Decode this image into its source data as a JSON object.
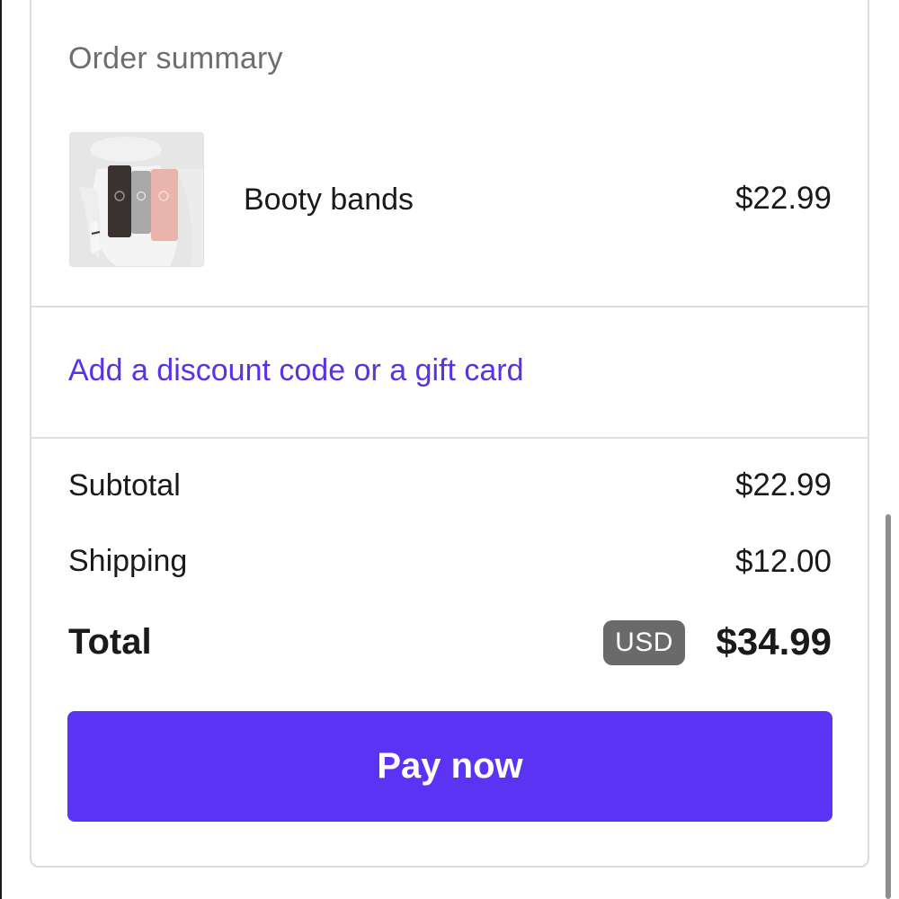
{
  "order_summary": {
    "title": "Order summary",
    "line_items": [
      {
        "image": "resistance-bands-product-photo",
        "name": "Booty bands",
        "price": "$22.99"
      }
    ]
  },
  "discount": {
    "link_label": "Add a discount code or a gift card"
  },
  "totals": {
    "subtotal_label": "Subtotal",
    "subtotal_value": "$22.99",
    "shipping_label": "Shipping",
    "shipping_value": "$12.00",
    "total_label": "Total",
    "currency": "USD",
    "total_value": "$34.99"
  },
  "actions": {
    "pay_label": "Pay now"
  },
  "colors": {
    "accent": "#5b33f5",
    "link": "#5a31e6",
    "badge": "#6a6a6a",
    "text": "#1a1a1a",
    "muted_text": "#6e6e6e",
    "divider": "#dedede"
  }
}
